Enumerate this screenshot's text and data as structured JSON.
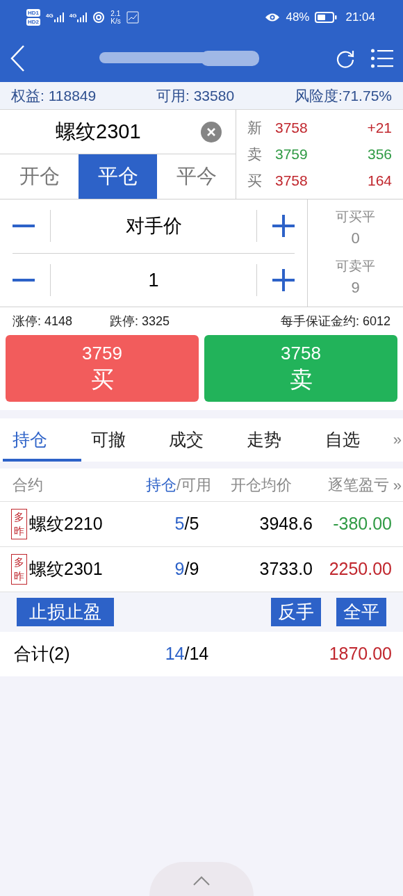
{
  "status_bar": {
    "sims": [
      "HD1",
      "HD2"
    ],
    "networks": [
      "4G",
      "4G"
    ],
    "speed_value": "2.1",
    "speed_unit": "K/s",
    "battery_percent": "48%",
    "time": "21:04"
  },
  "account": [
    "权益: 118849",
    "可用: 33580",
    "风险度:71.75%"
  ],
  "order": {
    "contract": "螺纹2301",
    "modes": [
      {
        "label": "开仓",
        "selected": false
      },
      {
        "label": "平仓",
        "selected": true
      },
      {
        "label": "平今",
        "selected": false
      }
    ],
    "quote": [
      {
        "label": "新",
        "price": {
          "text": "3758",
          "color": "#c0262d"
        },
        "volume": {
          "text": "+21",
          "color": "#c0262d"
        }
      },
      {
        "label": "卖",
        "price": {
          "text": "3759",
          "color": "#2f9a44"
        },
        "volume": {
          "text": "356",
          "color": "#2f9a44"
        }
      },
      {
        "label": "买",
        "price": {
          "text": "3758",
          "color": "#c0262d"
        },
        "volume": {
          "text": "164",
          "color": "#c0262d"
        }
      }
    ],
    "price_type": "对手价",
    "quantity": "1",
    "closable": [
      {
        "label": "可买平",
        "value": "0"
      },
      {
        "label": "可卖平",
        "value": "9"
      }
    ]
  },
  "limits": [
    "涨停: 4148",
    "跌停: 3325",
    "每手保证金约: 6012"
  ],
  "trade_buttons": [
    {
      "kind": "buy",
      "price": "3759",
      "label": "买"
    },
    {
      "kind": "sell",
      "price": "3758",
      "label": "卖"
    }
  ],
  "tabs": [
    {
      "label": "持仓",
      "selected": true
    },
    {
      "label": "可撤",
      "selected": false
    },
    {
      "label": "成交",
      "selected": false
    },
    {
      "label": "走势",
      "selected": false
    },
    {
      "label": "自选",
      "selected": false
    }
  ],
  "tabs_more": "»",
  "positions": {
    "columns": {
      "contract": "合约",
      "held": "持仓",
      "available": "/可用",
      "avg_price": "开仓均价",
      "pnl": "逐笔盈亏"
    },
    "columns_more": "»",
    "rows": [
      {
        "tag": "多昨",
        "contract": "螺纹2210",
        "held": "5",
        "available": "/5",
        "avg_price": "3948.6",
        "pnl": "-380.00",
        "color": "#2f9a44"
      },
      {
        "tag": "多昨",
        "contract": "螺纹2301",
        "held": "9",
        "available": "/9",
        "avg_price": "3733.0",
        "pnl": "2250.00",
        "color": "#c0262d"
      }
    ],
    "left_buttons": [
      "止损止盈"
    ],
    "right_buttons": [
      "反手",
      "全平"
    ],
    "total": {
      "label": "合计(2)",
      "held": "14",
      "available": "/14",
      "pnl": "1870.00",
      "color": "#c0262d"
    }
  }
}
